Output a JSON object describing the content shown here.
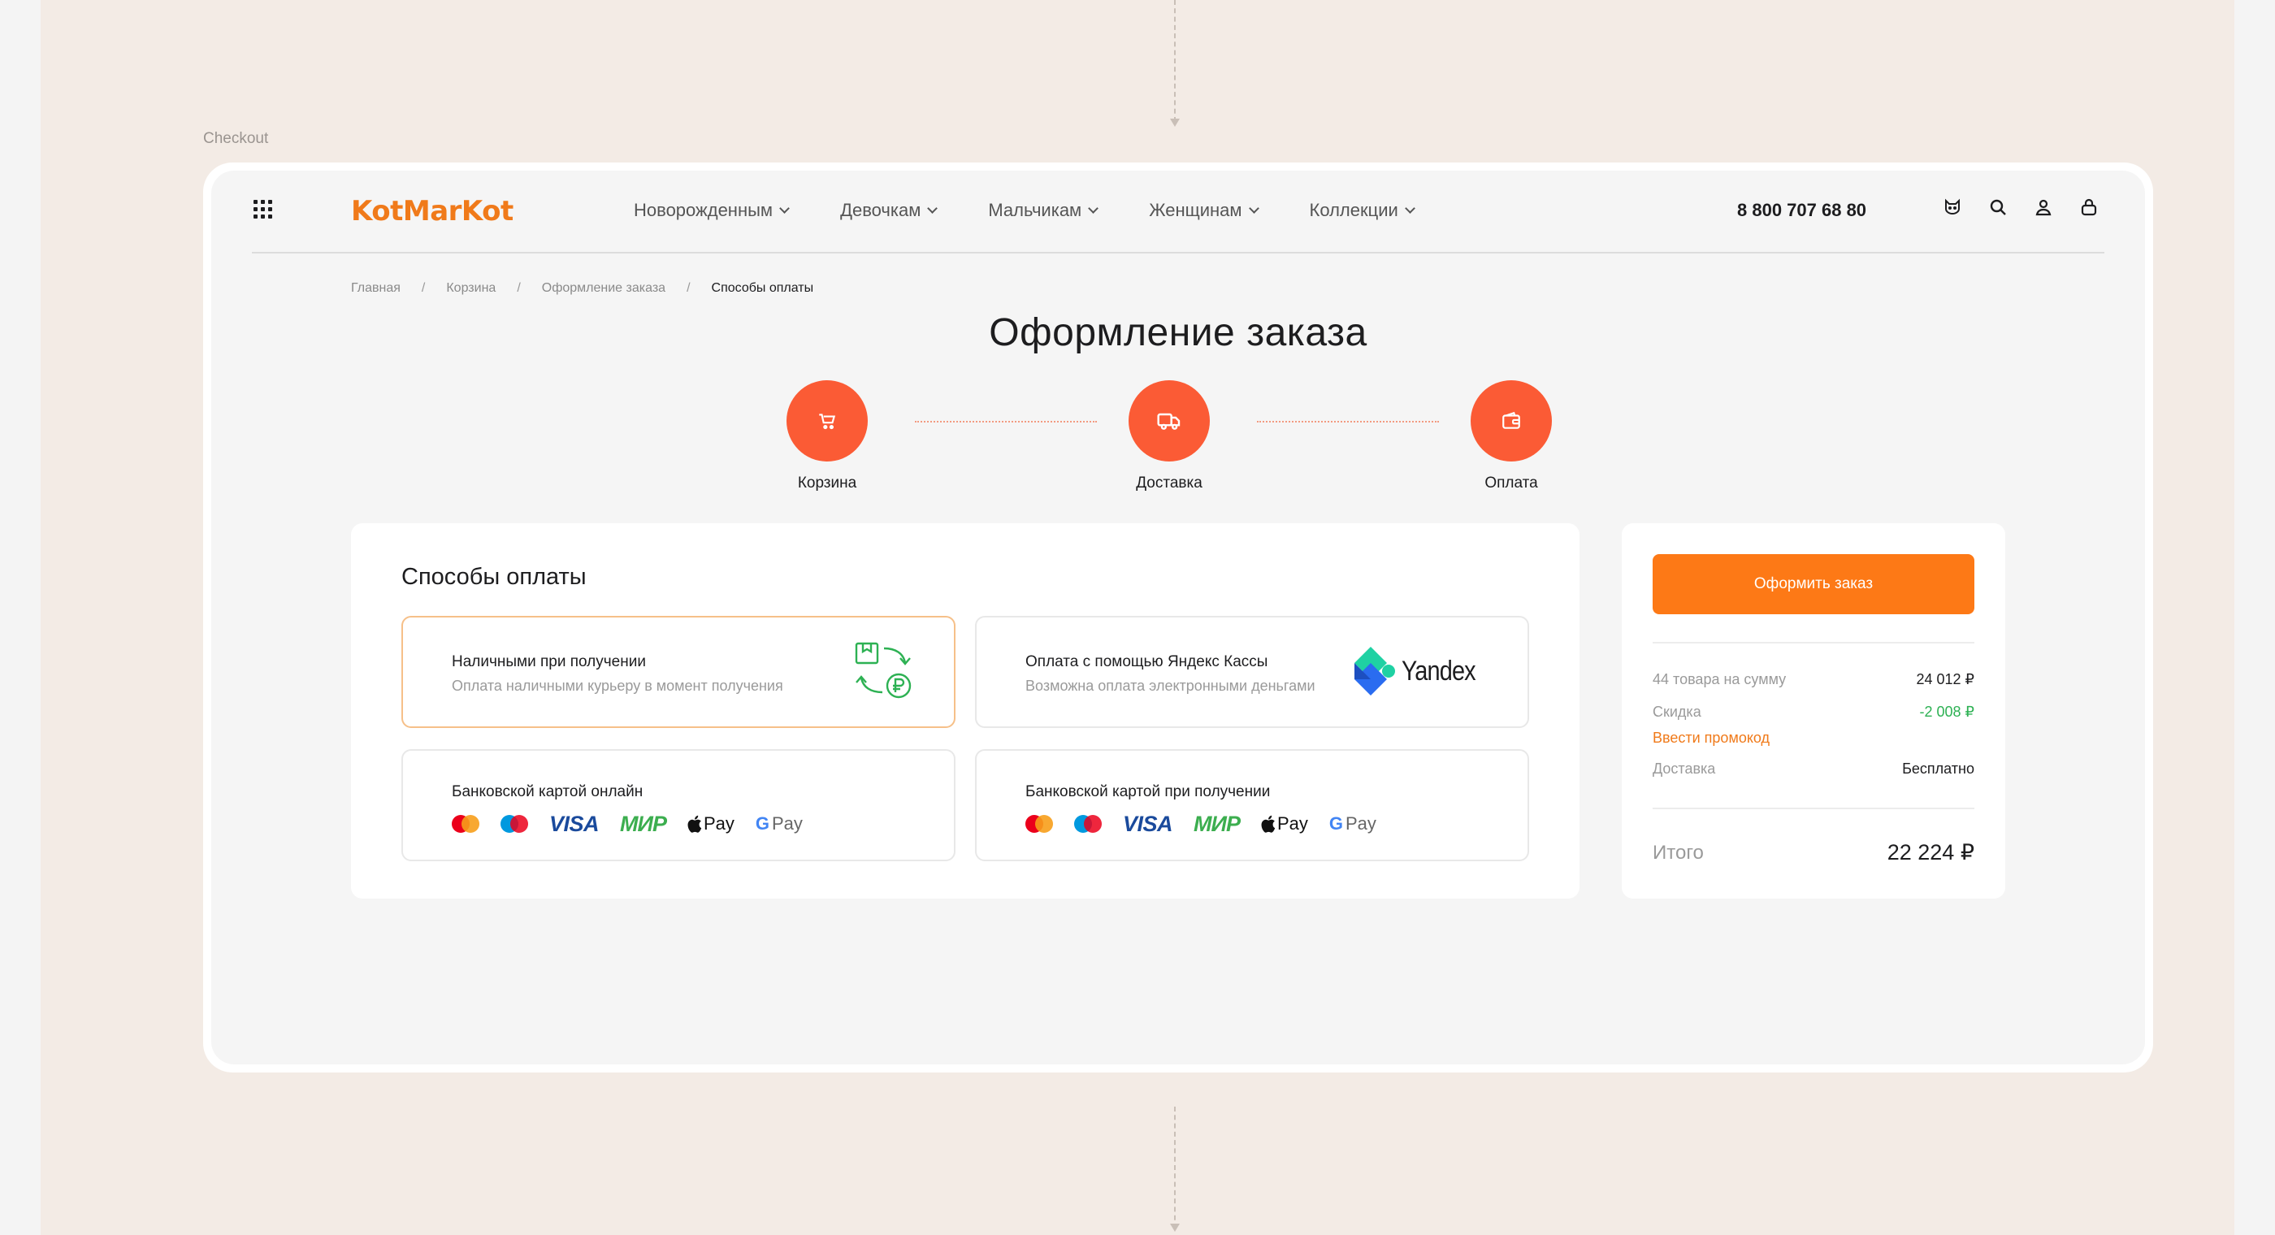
{
  "frame_label": "Checkout",
  "header": {
    "logo": "KotMarKot",
    "nav": [
      "Новорожденным",
      "Девочкам",
      "Мальчикам",
      "Женщинам",
      "Коллекции"
    ],
    "phone": "8 800 707 68 80"
  },
  "breadcrumb": [
    "Главная",
    "Корзина",
    "Оформление заказа",
    "Способы оплаты"
  ],
  "page_title": "Оформление заказа",
  "steps": [
    {
      "label": "Корзина",
      "icon": "cart-icon"
    },
    {
      "label": "Доставка",
      "icon": "truck-icon"
    },
    {
      "label": "Оплата",
      "icon": "wallet-icon"
    }
  ],
  "payment": {
    "title": "Способы оплаты",
    "options": [
      {
        "title": "Наличными при получении",
        "subtitle": "Оплата наличными курьеру в момент получения",
        "selected": true
      },
      {
        "title": "Оплата с помощью Яндекс Кассы",
        "subtitle": "Возможна оплата электронными деньгами",
        "selected": false,
        "brand": "Yandex"
      },
      {
        "title": "Банковской картой онлайн",
        "selected": false
      },
      {
        "title": "Банковской картой при получении",
        "selected": false
      }
    ],
    "card_brands": {
      "visa": "VISA",
      "mir": "МИР",
      "apple_pay": "Pay",
      "google_pay_g": "G",
      "google_pay": "Pay"
    }
  },
  "summary": {
    "order_button": "Оформить заказ",
    "items_label": "44 товара на сумму",
    "items_value": "24 012 ₽",
    "discount_label": "Скидка",
    "discount_value": "-2 008 ₽",
    "promo_link": "Ввести промокод",
    "delivery_label": "Доставка",
    "delivery_value": "Бесплатно",
    "total_label": "Итого",
    "total_value": "22 224 ₽"
  },
  "colors": {
    "accent_orange": "#fd7916",
    "step_red": "#fb5b35",
    "discount_green": "#2db153",
    "visa_blue": "#1a4a9c",
    "mir_green": "#3cae4f"
  }
}
